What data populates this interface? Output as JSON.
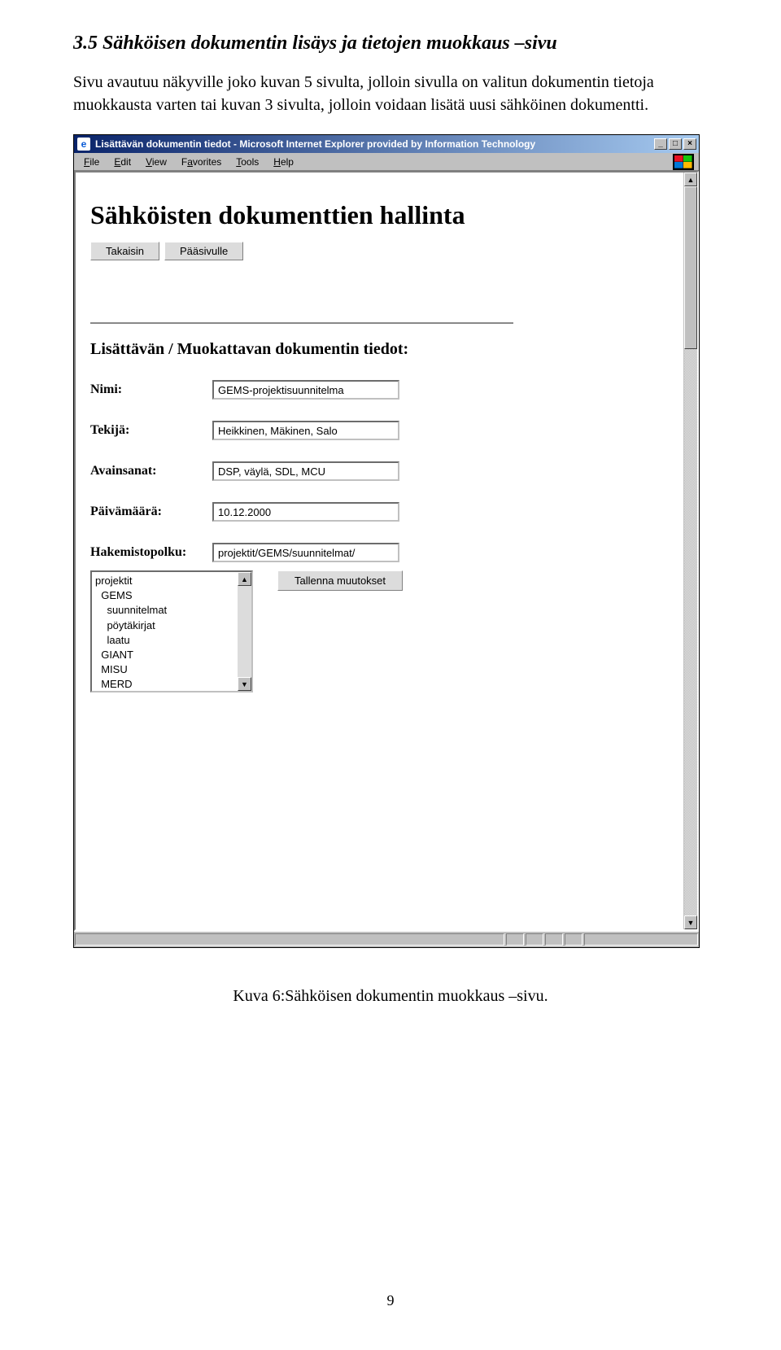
{
  "doc": {
    "section_heading": "3.5  Sähköisen dokumentin lisäys  ja tietojen muokkaus –sivu",
    "intro_text": "Sivu avautuu näkyville joko kuvan 5 sivulta, jolloin sivulla on valitun dokumentin tietoja muokkausta varten tai kuvan 3 sivulta, jolloin voidaan lisätä uusi sähköinen dokumentti.",
    "caption": "Kuva 6:Sähköisen dokumentin muokkaus –sivu.",
    "page_number": "9"
  },
  "browser": {
    "title": "Lisättävän dokumentin tiedot - Microsoft Internet Explorer provided by Information Technology",
    "menus": [
      "File",
      "Edit",
      "View",
      "Favorites",
      "Tools",
      "Help"
    ]
  },
  "page": {
    "heading": "Sähköisten dokumenttien hallinta",
    "buttons": {
      "back": "Takaisin",
      "home": "Pääsivulle"
    },
    "subheading": "Lisättävän / Muokattavan dokumentin tiedot:",
    "fields": {
      "nimi": {
        "label": "Nimi:",
        "value": "GEMS-projektisuunnitelma"
      },
      "tekija": {
        "label": "Tekijä:",
        "value": "Heikkinen, Mäkinen, Salo"
      },
      "avainsanat": {
        "label": "Avainsanat:",
        "value": "DSP, väylä, SDL, MCU"
      },
      "paivamaara": {
        "label": "Päivämäärä:",
        "value": "10.12.2000"
      },
      "hakemistopolku": {
        "label": "Hakemistopolku:",
        "value": "projektit/GEMS/suunnitelmat/"
      }
    },
    "listbox_text": "projektit\n  GEMS\n    suunnitelmat\n    pöytäkirjat\n    laatu\n  GIANT\n  MISU\n  MERD",
    "save_button": "Tallenna muutokset"
  }
}
